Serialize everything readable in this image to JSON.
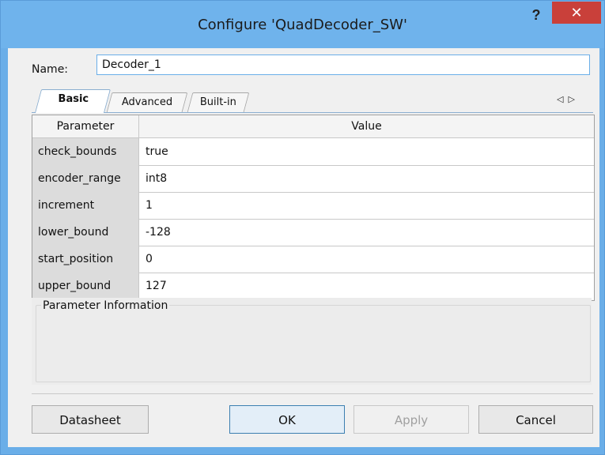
{
  "window": {
    "title": "Configure 'QuadDecoder_SW'",
    "help_glyph": "?",
    "close_glyph": "✕"
  },
  "name_field": {
    "label": "Name:",
    "value": "Decoder_1"
  },
  "tabs": [
    {
      "label": "Basic",
      "active": true
    },
    {
      "label": "Advanced",
      "active": false
    },
    {
      "label": "Built-in",
      "active": false
    }
  ],
  "tab_nav": {
    "left": "◁",
    "right": "▷"
  },
  "grid": {
    "headers": {
      "parameter": "Parameter",
      "value": "Value"
    },
    "rows": [
      {
        "name": "check_bounds",
        "value": "true"
      },
      {
        "name": "encoder_range",
        "value": "int8"
      },
      {
        "name": "increment",
        "value": "1"
      },
      {
        "name": "lower_bound",
        "value": "-128"
      },
      {
        "name": "start_position",
        "value": "0"
      },
      {
        "name": "upper_bound",
        "value": "127"
      }
    ]
  },
  "info": {
    "title": "Parameter Information"
  },
  "buttons": {
    "datasheet": "Datasheet",
    "ok": "OK",
    "apply": "Apply",
    "cancel": "Cancel"
  }
}
